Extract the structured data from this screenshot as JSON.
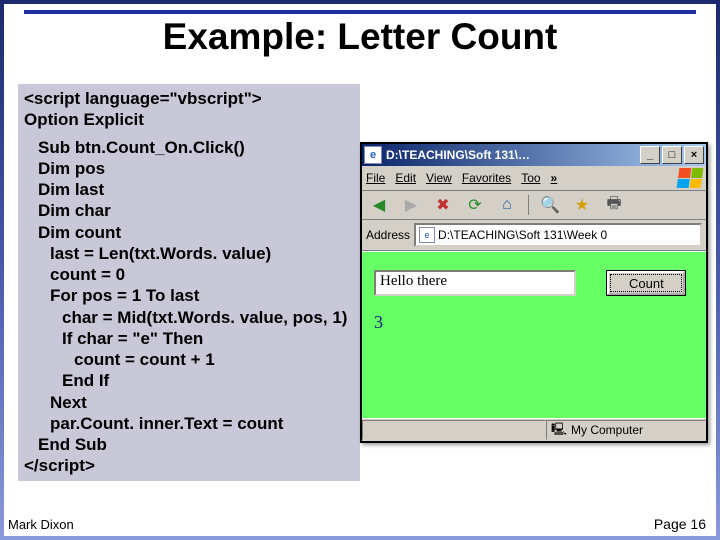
{
  "title": "Example: Letter Count",
  "code": {
    "l1": "<script language=\"vbscript\">",
    "l2": "Option Explicit",
    "l3": "Sub btn.Count_On.Click()",
    "l4": "Dim pos",
    "l5": "Dim last",
    "l6": "Dim char",
    "l7": "Dim count",
    "l8": "last = Len(txt.Words. value)",
    "l9": "count = 0",
    "l10": "For pos = 1 To last",
    "l11": "char = Mid(txt.Words. value, pos, 1)",
    "l12": "If char = \"e\" Then",
    "l13": "count = count + 1",
    "l14": "End If",
    "l15": "Next",
    "l16": "par.Count. inner.Text = count",
    "l17": "End Sub",
    "l18": "</script>"
  },
  "ie": {
    "title": "D:\\TEACHING\\Soft 131\\…",
    "menu": [
      "File",
      "Edit",
      "View",
      "Favorites",
      "Too"
    ],
    "chev": "»",
    "addr_label": "Address",
    "addr_value": "D:\\TEACHING\\Soft 131\\Week 0",
    "input_value": "Hello there",
    "count_label": "Count",
    "result": "3",
    "status": "My Computer",
    "btn_min": "_",
    "btn_max": "□",
    "btn_close": "×"
  },
  "footer": {
    "left": "Mark Dixon",
    "right": "Page 16"
  }
}
